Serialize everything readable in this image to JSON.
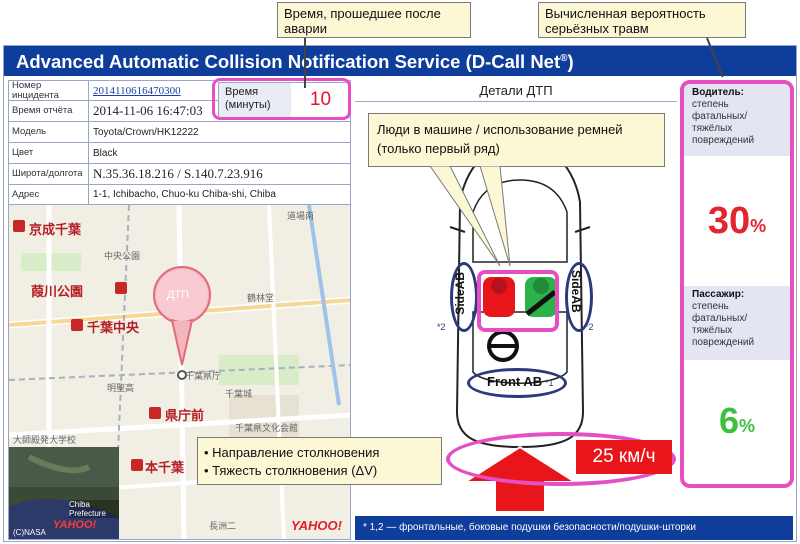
{
  "header": {
    "title": "Advanced Automatic Collision Notification Service (D-Call Net",
    "title_sup": "®",
    "title_end": ")"
  },
  "callouts": {
    "elapsed_time": "Время, прошедшее после аварии",
    "severe_injury": "Вычисленная вероятность серьёзных травм",
    "occupants": "Люди в машине / использование ремней (только первый ряд)",
    "collision_direction": "Направление столкновения",
    "collision_severity": "Тяжесть столкновения (ΔV)"
  },
  "incident": {
    "rows": [
      {
        "label": "Номер инцидента",
        "value": "2014110616470300"
      },
      {
        "label": "Время отчёта",
        "value": "2014-11-06 16:47:03"
      },
      {
        "label": "Модель",
        "value": "Toyota/Crown/HK12222"
      },
      {
        "label": "Цвет",
        "value": "Black"
      },
      {
        "label": "Широта/долгота",
        "value": "N.35.36.18.216   /   S.140.7.23.916"
      },
      {
        "label": "Адрес",
        "value": "1-1, Ichibacho, Chuo-ku Chiba-shi, Chiba"
      }
    ],
    "time_label": "Время (минуты)",
    "time_value": "10"
  },
  "map": {
    "pin_label": "ДТП",
    "labels": {
      "keisei_chiba": "京成千葉",
      "sakaigawa_park": "葭川公園",
      "chiba_chuo": "千葉中央",
      "kencho_mae": "県庁前",
      "hon_chiba": "本千葉",
      "chiba_pref_office": "千葉県庁",
      "chiba_castle": "千葉城",
      "culture_hall": "千葉県文化会館",
      "chuo_park": "中央公園",
      "tsurugaya": "鶴林堂",
      "dojo": "道場南",
      "meiden": "明聖高",
      "univ": "大師殿発大学校",
      "nagasu": "長洲二",
      "prefecture_en": "Chiba Prefecture",
      "copyright": "(C)NASA",
      "yahoo_left": "YAHOO!",
      "yahoo_right": "YAHOO!"
    }
  },
  "details": {
    "title": "Детали ДТП",
    "side_ab_left": "SideAB",
    "side_ab_right": "SideAB",
    "mark_left": "*2",
    "mark_right": "*2",
    "front_ab": "Front AB",
    "front_ab_mark": "*1",
    "speed": "25 км/ч",
    "footnote": "* 1,2 — фронтальные, боковые подушки безопасности/подушки-шторки"
  },
  "risk": {
    "driver_label_bold": "Водитель:",
    "driver_label": "степень фатальных/ тяжёлых повреждений",
    "driver_value": "30",
    "driver_unit": "%",
    "driver_color": "#e3262e",
    "passenger_label_bold": "Пассажир:",
    "passenger_label": "степень фатальных/ тяжёлых повреждений",
    "passenger_value": "6",
    "passenger_unit": "%",
    "passenger_color": "#3cc13e"
  },
  "colors": {
    "header": "#0e3d9c",
    "highlight": "#e64fc3",
    "speed": "#e8161b",
    "callout_bg": "#fcf8d6"
  }
}
